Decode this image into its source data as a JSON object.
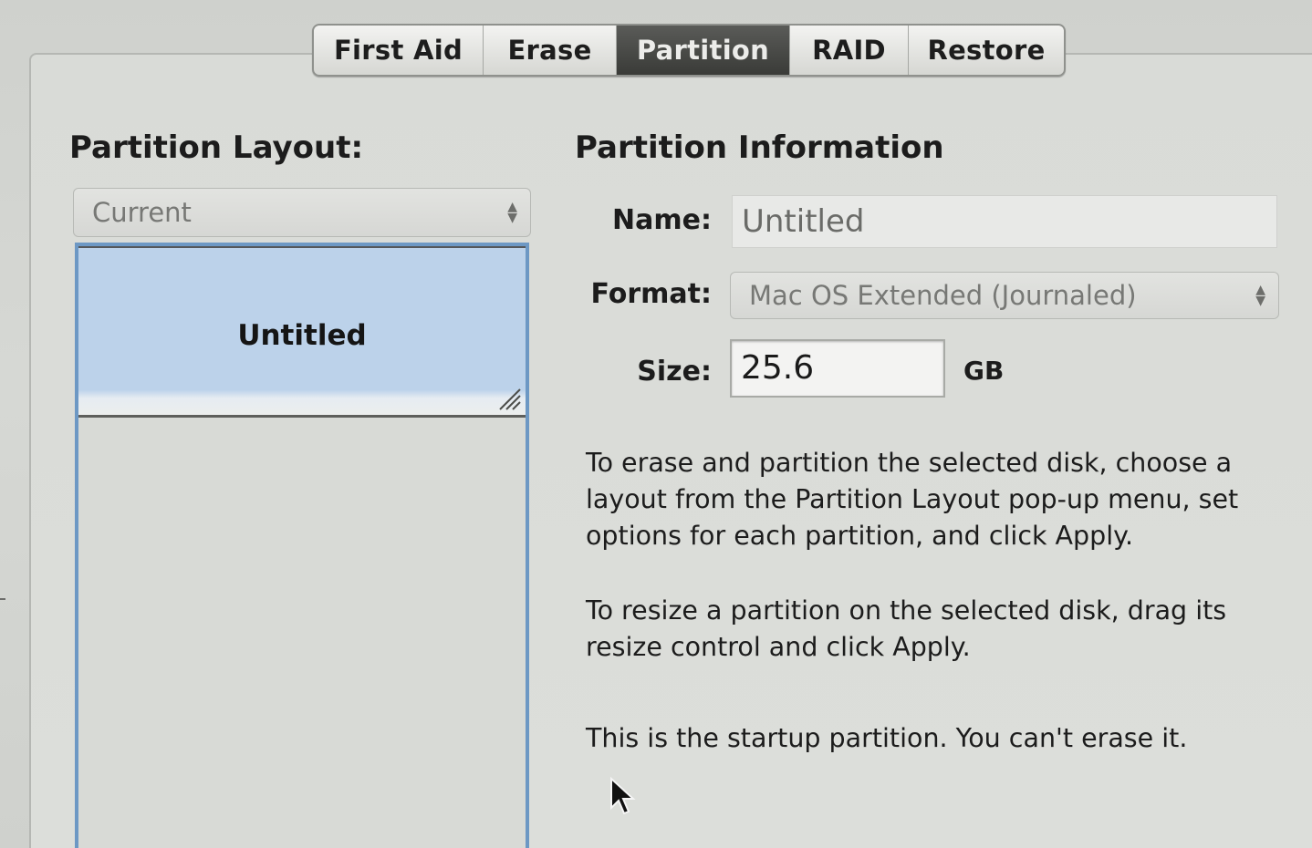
{
  "tabs": [
    {
      "label": "First Aid",
      "selected": false
    },
    {
      "label": "Erase",
      "selected": false
    },
    {
      "label": "Partition",
      "selected": true
    },
    {
      "label": "RAID",
      "selected": false
    },
    {
      "label": "Restore",
      "selected": false
    }
  ],
  "layout": {
    "title": "Partition Layout:",
    "popup_value": "Current",
    "partition_name": "Untitled"
  },
  "info": {
    "title": "Partition Information",
    "name_label": "Name:",
    "name_value": "Untitled",
    "format_label": "Format:",
    "format_value": "Mac OS Extended (Journaled)",
    "size_label": "Size:",
    "size_value": "25.6",
    "size_unit": "GB",
    "paragraphs": [
      "To erase and partition the selected disk, choose a layout from the Partition Layout pop-up menu, set options for each partition, and click Apply.",
      "To resize a partition on the selected disk, drag its resize control and click Apply.",
      "This is the startup partition. You can't erase it."
    ]
  },
  "colors": {
    "selected_tab": "#3f403d",
    "partition_fill": "#bcd2ea",
    "layout_border": "#6d98c4"
  }
}
